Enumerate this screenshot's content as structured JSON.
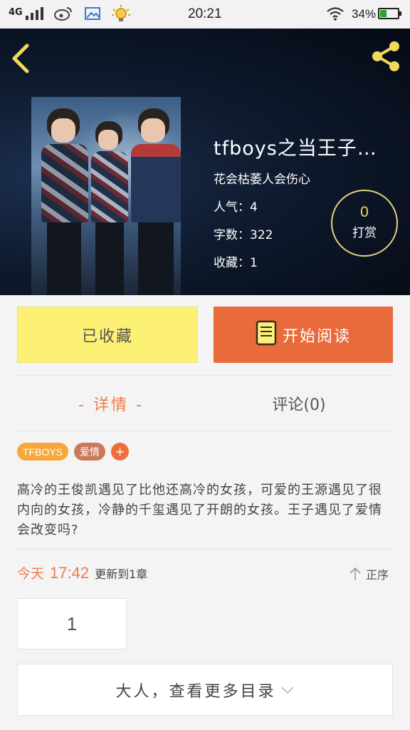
{
  "status_bar": {
    "network": "4G",
    "time": "20:21",
    "battery_percent": "34%",
    "battery_level": 0.34,
    "icons": [
      "signal-icon",
      "weibo-icon",
      "gallery-icon",
      "bulb-icon",
      "wifi-icon",
      "battery-icon"
    ]
  },
  "header": {
    "back_icon": "chevron-left-icon",
    "share_icon": "share-icon"
  },
  "book": {
    "title": "tfboys之当王子遇…",
    "author": "花会枯萎人会伤心",
    "popularity": "人气：4",
    "word_count": "字数：322",
    "favorites": "收藏：1"
  },
  "reward": {
    "count": "0",
    "label": "打赏"
  },
  "actions": {
    "collected_label": "已收藏",
    "read_label": "开始阅读"
  },
  "tabs": {
    "detail": "- 详情 -",
    "comments": "评论(0)"
  },
  "tags": [
    "TFBOYS",
    "爱情"
  ],
  "add_tag": "+",
  "description": "高冷的王俊凯遇见了比他还高冷的女孩，可爱的王源遇见了很内向的女孩，冷静的千玺遇见了开朗的女孩。王子遇见了爱情会改变吗?",
  "update": {
    "day": "今天",
    "time": "17:42",
    "info": "更新到1章"
  },
  "sort_label": "正序",
  "chapters": [
    "1"
  ],
  "more_label": "大人，查看更多目录",
  "colors": {
    "accent": "#ef7a4b",
    "collected_bg": "#fcf175",
    "read_bg": "#e96b3c",
    "reward_border": "#e7d27c"
  }
}
